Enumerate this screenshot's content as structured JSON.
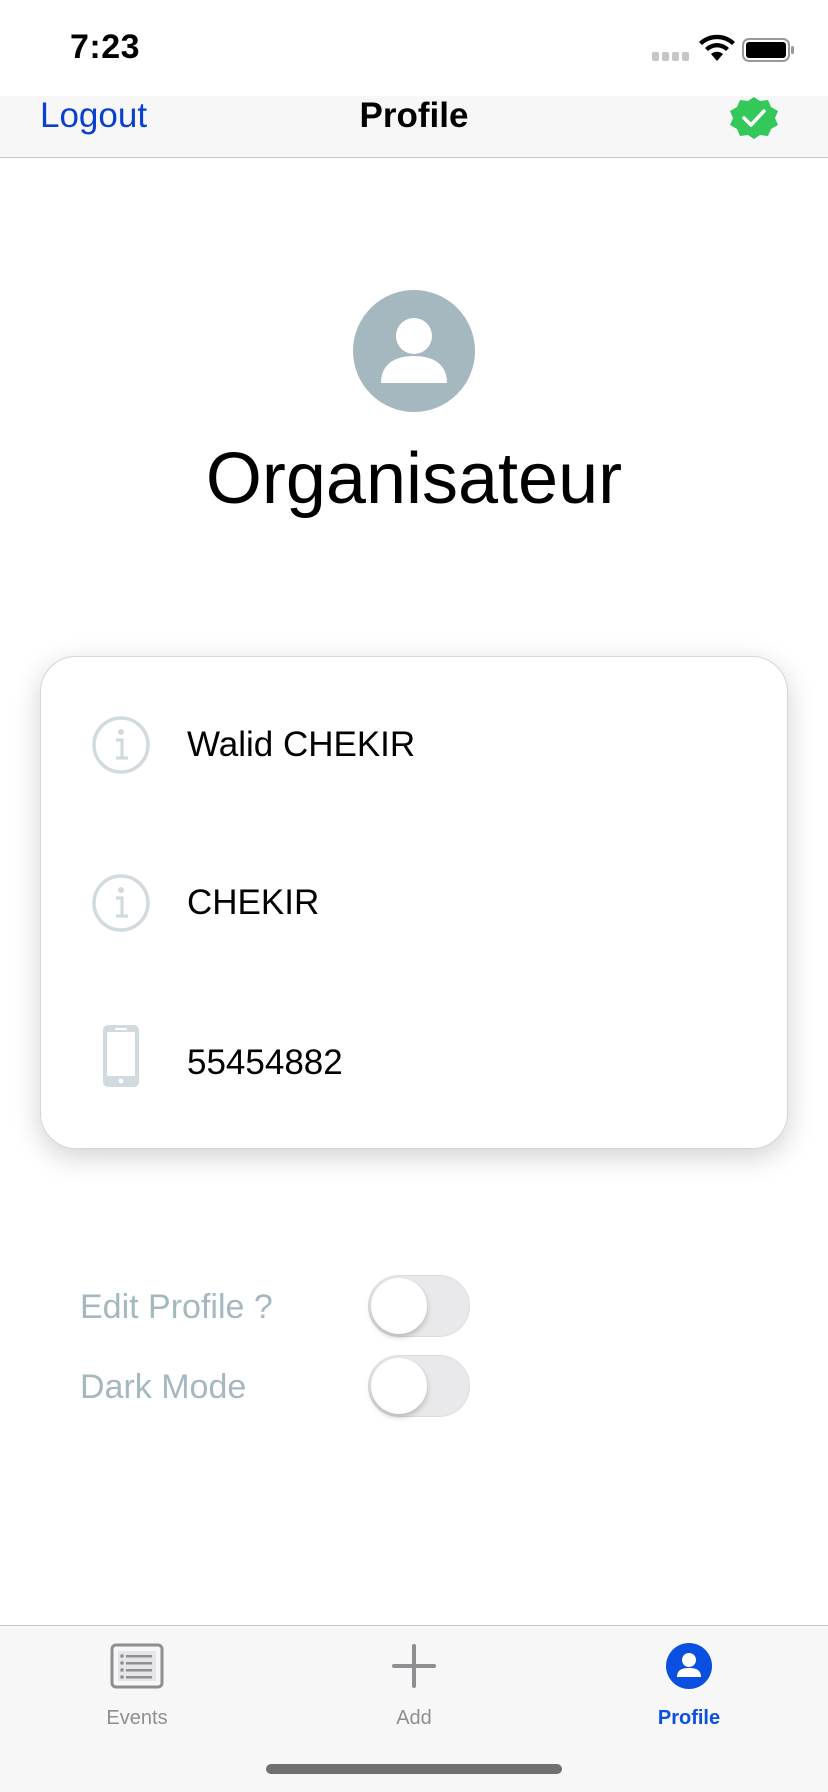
{
  "status_bar": {
    "time": "7:23"
  },
  "nav": {
    "left_label": "Logout",
    "title": "Profile",
    "right_icon": "verified-badge-icon"
  },
  "profile": {
    "role": "Organisateur",
    "avatar_icon": "person-icon"
  },
  "card": {
    "rows": [
      {
        "icon": "info-icon",
        "value": "Walid CHEKIR"
      },
      {
        "icon": "info-icon",
        "value": "CHEKIR"
      },
      {
        "icon": "phone-icon",
        "value": "55454882"
      }
    ]
  },
  "settings": [
    {
      "label": "Edit Profile ?",
      "enabled": false
    },
    {
      "label": "Dark Mode",
      "enabled": false
    }
  ],
  "tabs": [
    {
      "label": "Events",
      "icon": "list-icon",
      "active": false
    },
    {
      "label": "Add",
      "icon": "plus-icon",
      "active": false
    },
    {
      "label": "Profile",
      "icon": "person-circle-icon",
      "active": true
    }
  ],
  "colors": {
    "accent": "#0a3fcf",
    "muted": "#a5b8c0",
    "badge_green": "#34c759"
  }
}
